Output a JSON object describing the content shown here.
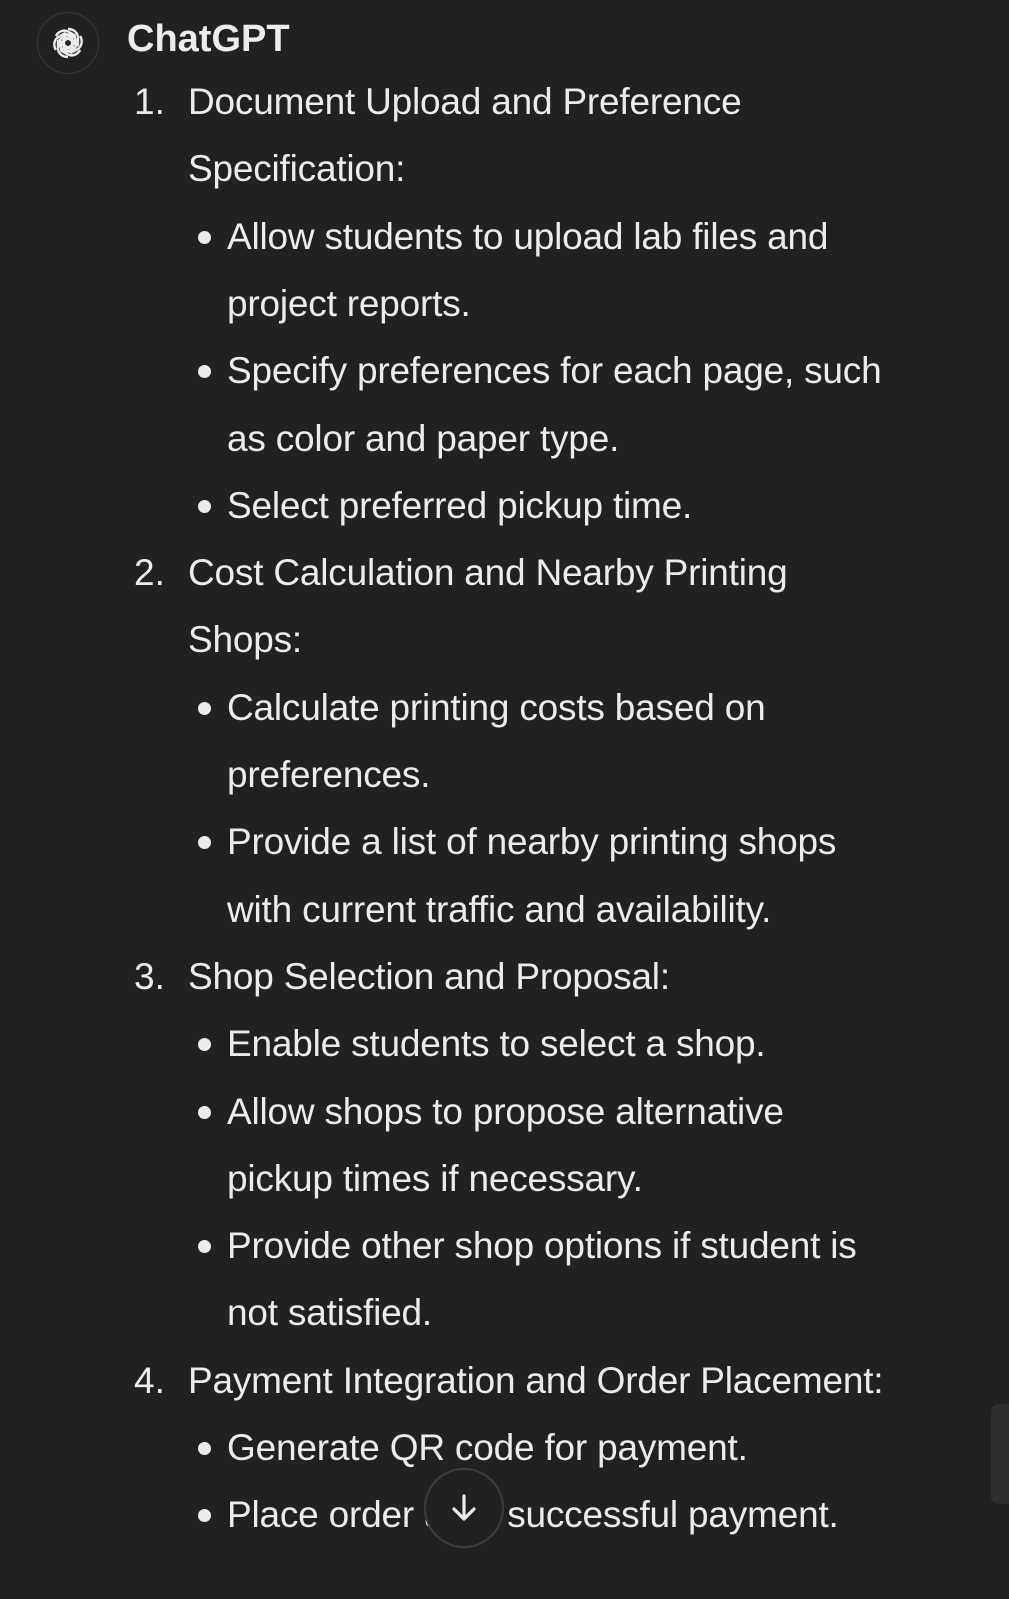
{
  "message": {
    "author": "ChatGPT",
    "avatar_icon": "openai-logo-icon",
    "sections": [
      {
        "number": "1.",
        "title_lines": [
          "Document Upload and Preference",
          "Specification:"
        ],
        "bullets": [
          [
            "Allow students to upload lab files and",
            "project reports."
          ],
          [
            "Specify preferences for each page, such",
            "as color and paper type."
          ],
          [
            "Select preferred pickup time."
          ]
        ]
      },
      {
        "number": "2.",
        "title_lines": [
          "Cost Calculation and Nearby Printing",
          "Shops:"
        ],
        "bullets": [
          [
            "Calculate printing costs based on",
            "preferences."
          ],
          [
            "Provide a list of nearby printing shops",
            "with current traffic and availability."
          ]
        ]
      },
      {
        "number": "3.",
        "title_lines": [
          "Shop Selection and Proposal:"
        ],
        "bullets": [
          [
            "Enable students to select a shop."
          ],
          [
            "Allow shops to propose alternative",
            "pickup times if necessary."
          ],
          [
            "Provide other shop options if student is",
            "not satisfied."
          ]
        ]
      },
      {
        "number": "4.",
        "title_lines": [
          "Payment Integration and Order Placement:"
        ],
        "bullets": [
          [
            "Generate QR code for payment."
          ],
          [
            "Place order after successful payment."
          ]
        ]
      }
    ]
  },
  "scroll_button": {
    "icon": "arrow-down-icon"
  },
  "colors": {
    "background": "#212121",
    "text": "#ececec"
  }
}
